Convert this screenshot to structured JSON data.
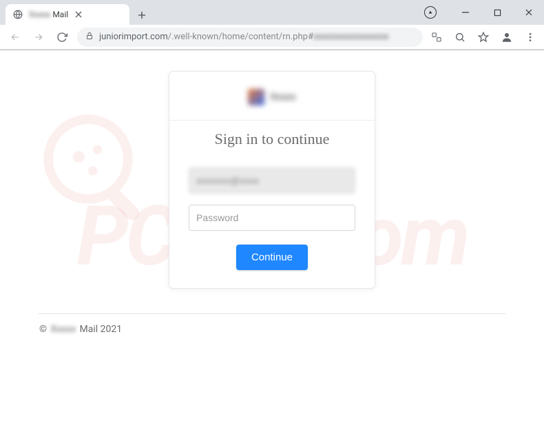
{
  "browser": {
    "tab": {
      "favicon": "globe",
      "title_blur": "Xxxxx",
      "title_clear": "Mail"
    },
    "url": {
      "host": "juniorimport.com",
      "path": "/.well-known/home/content/rn.php#",
      "fragment_blur": "xxxxxxxxxxxxxxxxx"
    }
  },
  "card": {
    "brand_text": "Xxxxx",
    "title": "Sign in to continue",
    "email_value": "xxxxxxx@xxxx",
    "password_placeholder": "Password",
    "button_label": "Continue"
  },
  "footer": {
    "copyright_prefix": "©",
    "brand_blur": "Xxxxx",
    "suffix": "Mail 2021"
  },
  "watermark": {
    "text": "PCrisk.com"
  }
}
